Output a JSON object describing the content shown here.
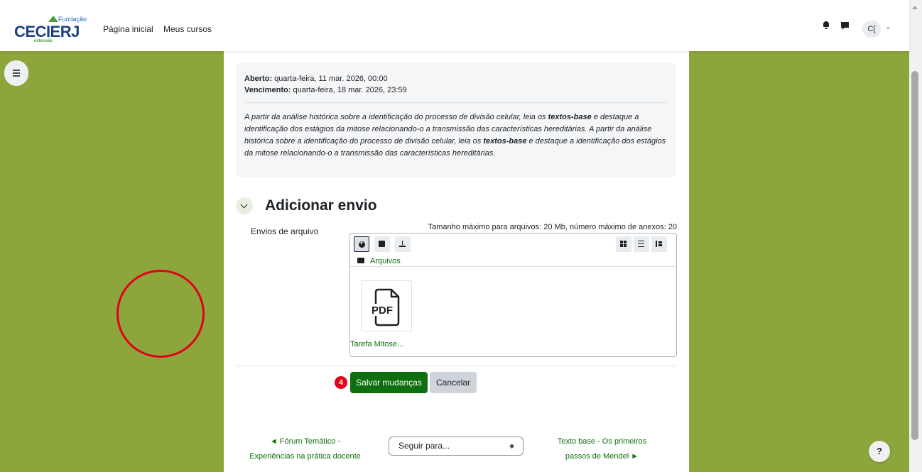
{
  "nav": {
    "logo_brand": "CECIERJ",
    "logo_top": "Fundação",
    "logo_bottom": "extensão",
    "links": [
      "Página inicial",
      "Meus cursos"
    ],
    "avatar_initials": "C["
  },
  "assignment": {
    "opened_label": "Aberto:",
    "opened_value": " quarta-feira, 11 mar. 2026, 00:00",
    "due_label": "Vencimento:",
    "due_value": " quarta-feira, 18 mar. 2026, 23:59",
    "description_before": "A partir da análise histórica sobre a identificação do processo de divisão celular, leia os ",
    "description_bold": "textos-base",
    "description_after": " e destaque a identificação dos estágios da mitose relacionando-o a transmissão das características hereditárias."
  },
  "submission": {
    "section_title": "Adicionar envio",
    "field_label": "Envios de arquivo",
    "limits": "Tamanho máximo para arquivos: 20 Mb, número máximo de anexos: 20",
    "folder_label": "Arquivos",
    "file": {
      "type_label": "PDF",
      "name": "Tarefa Mitose..."
    },
    "step_number": "4",
    "save_label": "Salvar mudanças",
    "cancel_label": "Cancelar"
  },
  "footer_nav": {
    "prev_line1": "◄ Fórum Temático  -",
    "prev_line2": "Experiências na prática docente",
    "jump_placeholder": "Seguir para...",
    "next_line1": "Texto base - Os primeiros",
    "next_line2": "passos de Mendel ►"
  },
  "help_label": "?",
  "colors": {
    "page_background": "#8da63c",
    "primary_button": "#0f6e0f",
    "link": "#0f6e0f",
    "annotation_red": "#e2001a",
    "logo_blue": "#1c3f86"
  }
}
